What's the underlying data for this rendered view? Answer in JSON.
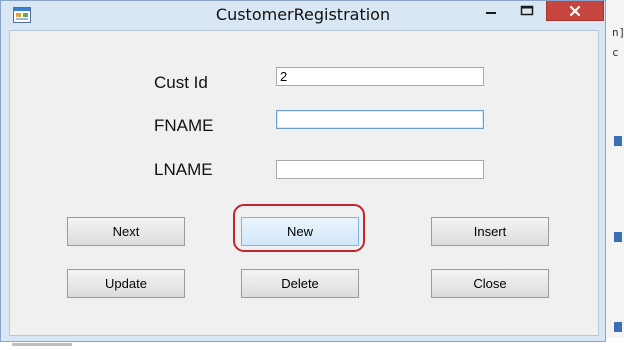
{
  "window": {
    "title": "CustomerRegistration",
    "icons": {
      "app": "app-icon",
      "minimize": "minimize-icon",
      "maximize": "maximize-icon",
      "close": "close-icon"
    },
    "accent_close": "#c7453f"
  },
  "form": {
    "fields": [
      {
        "label": "Cust Id",
        "value": "2",
        "placeholder": ""
      },
      {
        "label": "FNAME",
        "value": "",
        "placeholder": ""
      },
      {
        "label": "LNAME",
        "value": "",
        "placeholder": ""
      }
    ],
    "buttons": {
      "next": "Next",
      "new": "New",
      "insert": "Insert",
      "update": "Update",
      "delete": "Delete",
      "close": "Close"
    },
    "highlight_color": "#c0262a"
  },
  "background": {
    "ide_text": [
      "n]",
      "c"
    ]
  }
}
